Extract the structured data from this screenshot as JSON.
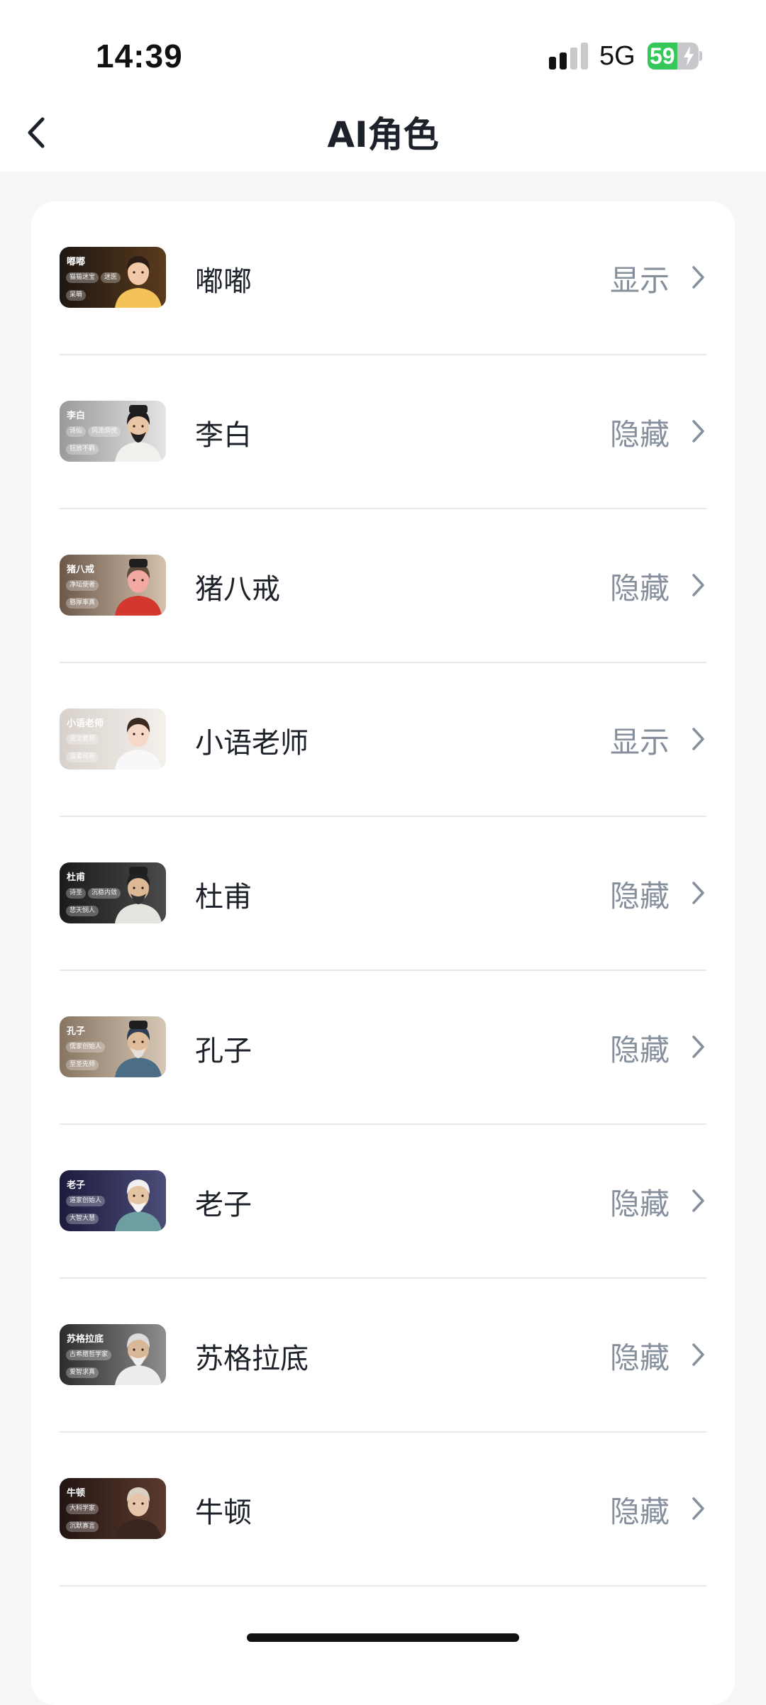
{
  "status_bar": {
    "time": "14:39",
    "network": "5G",
    "battery": "59",
    "battery_level": 0.59
  },
  "nav": {
    "title": "AI角色"
  },
  "characters": [
    {
      "name": "嘟嘟",
      "status": "显示",
      "thumb_name": "嘟嘟",
      "tags": [
        "猫猫迷宝",
        "迷医",
        "呆萌"
      ],
      "thumb_bg": [
        "#1e1712",
        "#5a3b1d"
      ],
      "face": "#f2c9a6",
      "hair": "#2b1d14",
      "robe": "#f3c35a",
      "beard": false,
      "hat": false
    },
    {
      "name": "李白",
      "status": "隐藏",
      "thumb_name": "李白",
      "tags": [
        "诗仙",
        "风流倜傥",
        "狂放不羁"
      ],
      "thumb_bg": [
        "#9a9a9a",
        "#e4e4e4"
      ],
      "face": "#e9c7a6",
      "hair": "#1c1c1c",
      "robe": "#f1f1ee",
      "beard": true,
      "beard_color": "#222",
      "hat": true
    },
    {
      "name": "猪八戒",
      "status": "隐藏",
      "thumb_name": "猪八戒",
      "tags": [
        "净坛使者",
        "憨厚率真"
      ],
      "thumb_bg": [
        "#6c5849",
        "#d4c2ae"
      ],
      "face": "#f1a9a2",
      "hair": "#5e4a3a",
      "robe": "#d2382d",
      "beard": false,
      "hat": true
    },
    {
      "name": "小语老师",
      "status": "显示",
      "thumb_name": "小语老师",
      "tags": [
        "语文老师",
        "温柔可亲"
      ],
      "thumb_bg": [
        "#d8d1cb",
        "#f4f0ec"
      ],
      "face": "#f5d8c7",
      "hair": "#3a2a20",
      "robe": "#f8f8f8",
      "beard": false,
      "hat": false
    },
    {
      "name": "杜甫",
      "status": "隐藏",
      "thumb_name": "杜甫",
      "tags": [
        "诗圣",
        "沉稳内敛",
        "悲天悯人"
      ],
      "thumb_bg": [
        "#1b1b1b",
        "#4a4a4a"
      ],
      "face": "#dcb895",
      "hair": "#222",
      "robe": "#e6e4df",
      "beard": true,
      "beard_color": "#333",
      "hat": true
    },
    {
      "name": "孔子",
      "status": "隐藏",
      "thumb_name": "孔子",
      "tags": [
        "儒家创始人",
        "至圣先师"
      ],
      "thumb_bg": [
        "#877462",
        "#d7c8b6"
      ],
      "face": "#dfbd9b",
      "hair": "#2e3f55",
      "robe": "#4b6d87",
      "beard": true,
      "beard_color": "#e5e1da",
      "hat": true
    },
    {
      "name": "老子",
      "status": "隐藏",
      "thumb_name": "老子",
      "tags": [
        "道家创始人",
        "大智大慧"
      ],
      "thumb_bg": [
        "#1d1b3d",
        "#4b4d78"
      ],
      "face": "#e3c4a3",
      "hair": "#f0f0f0",
      "robe": "#6e9da2",
      "beard": true,
      "beard_color": "#f4f4f4",
      "hat": false
    },
    {
      "name": "苏格拉底",
      "status": "隐藏",
      "thumb_name": "苏格拉底",
      "tags": [
        "古希腊哲学家",
        "爱智求真"
      ],
      "thumb_bg": [
        "#2c2c2c",
        "#8e8e8e"
      ],
      "face": "#d9b898",
      "hair": "#dcdcdc",
      "robe": "#ececec",
      "beard": true,
      "beard_color": "#efefef",
      "hat": false
    },
    {
      "name": "牛顿",
      "status": "隐藏",
      "thumb_name": "牛顿",
      "tags": [
        "大科学家",
        "沉默寡言"
      ],
      "thumb_bg": [
        "#221512",
        "#5b3a2e"
      ],
      "face": "#e6c6aa",
      "hair": "#d9d0c4",
      "robe": "#3a2520",
      "beard": false,
      "hat": false
    }
  ]
}
